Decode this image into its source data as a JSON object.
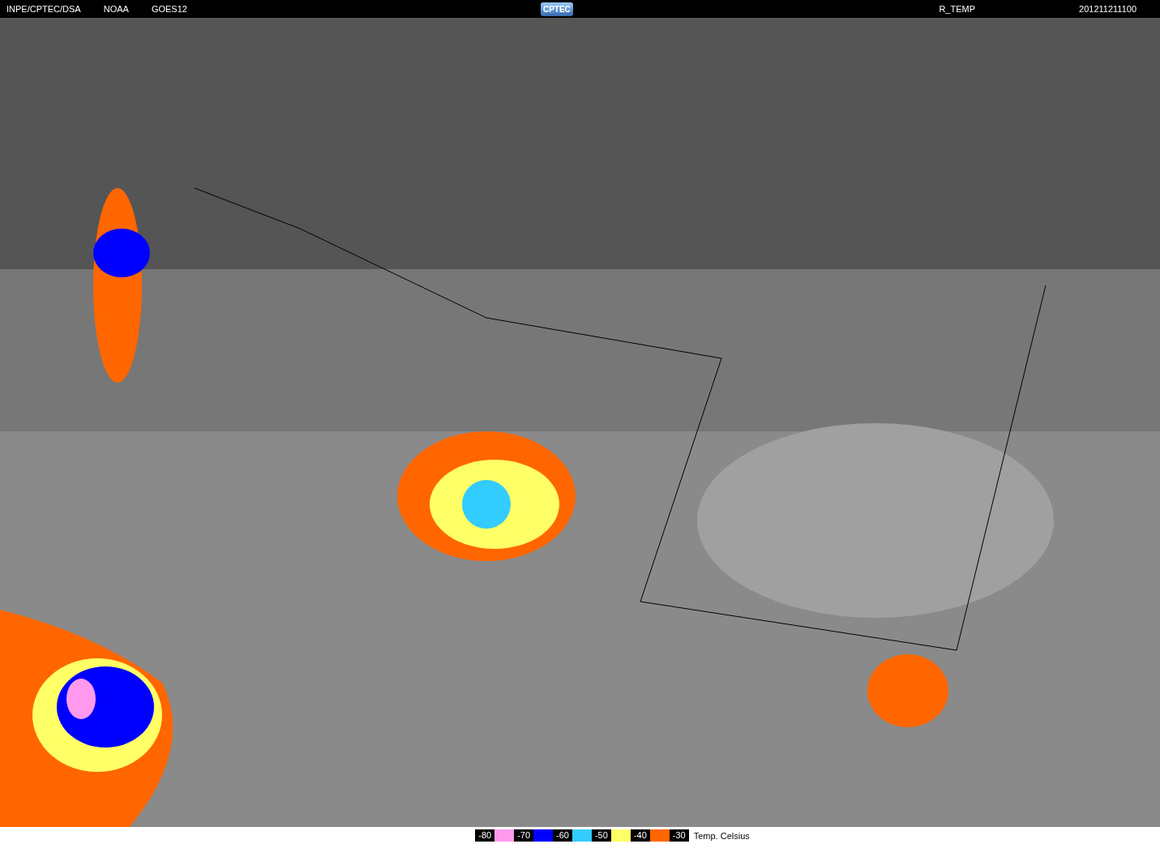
{
  "header": {
    "left_labels": [
      "INPE/CPTEC/DSA",
      "NOAA",
      "GOES12"
    ],
    "logo": "CPTEC",
    "product": "R_TEMP",
    "timestamp": "201211211100"
  },
  "legend": {
    "entries": [
      {
        "label": "-80",
        "color": "#ff99ee"
      },
      {
        "label": "-70",
        "color": "#0000ff"
      },
      {
        "label": "-60",
        "color": "#33ccff"
      },
      {
        "label": "-50",
        "color": "#ffff66"
      },
      {
        "label": "-40",
        "color": "#ff6600"
      },
      {
        "label": "-30"
      }
    ],
    "unit": "Temp. Celsius"
  }
}
